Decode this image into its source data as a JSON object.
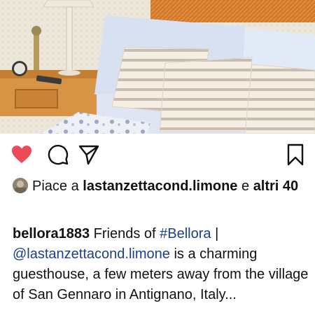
{
  "post": {
    "likes": {
      "prefix": "Piace a",
      "account": "lastanzettacond.limone",
      "joiner": "e",
      "others": "altri 40"
    },
    "caption": {
      "author": "bellora1883",
      "text_1": "Friends of",
      "hashtag": "#Bellora",
      "separator": "|",
      "mention": "@lastanzettacond.limone",
      "text_2": "is a charming guesthouse, a few meters away from the village of San Gennaro in Antignano, Italy..."
    }
  },
  "icons": {
    "like": "heart-icon",
    "comment": "comment-bubble-icon",
    "share": "paper-plane-icon",
    "save": "bookmark-icon"
  },
  "colors": {
    "like_active": "#ed4956",
    "link": "#1c3f8a",
    "text": "#111111"
  }
}
